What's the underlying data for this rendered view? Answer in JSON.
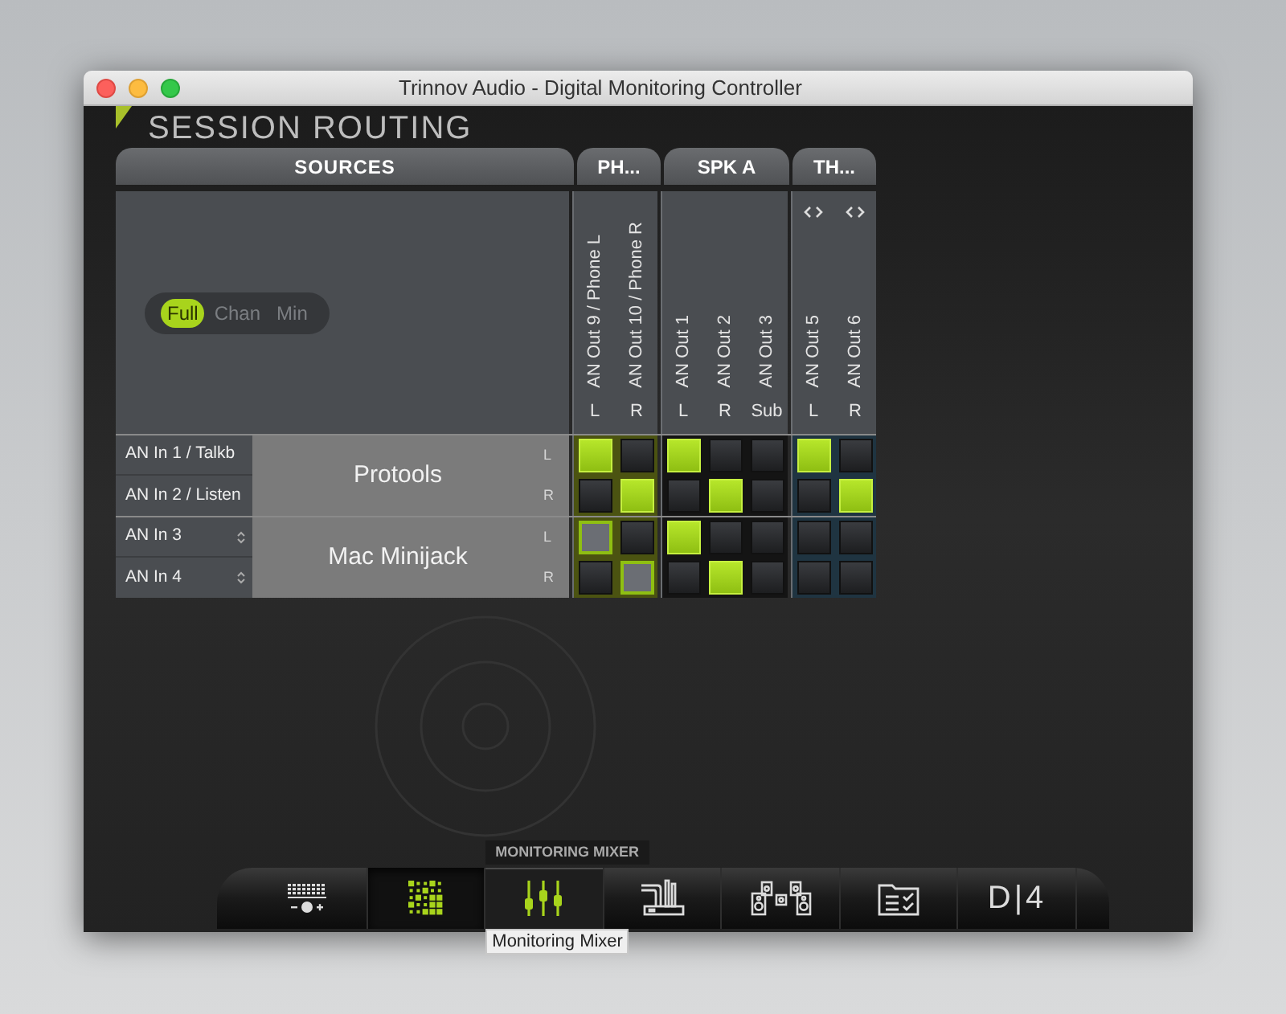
{
  "window": {
    "title": "Trinnov Audio - Digital Monitoring Controller"
  },
  "header": {
    "title": "SESSION ROUTING"
  },
  "sources_tab": "SOURCES",
  "view_toggle": [
    {
      "label": "Full",
      "selected": true
    },
    {
      "label": "Chan",
      "selected": false
    },
    {
      "label": "Min",
      "selected": false
    }
  ],
  "output_groups": [
    {
      "label": "PH...",
      "color": "#4b5311",
      "arrows": false,
      "columns": [
        {
          "name": "AN Out 9 / Phone L",
          "channel": "L"
        },
        {
          "name": "AN Out 10 / Phone R",
          "channel": "R"
        }
      ]
    },
    {
      "label": "SPK A",
      "color": "#141414",
      "arrows": false,
      "columns": [
        {
          "name": "AN Out 1",
          "channel": "L"
        },
        {
          "name": "AN Out 2",
          "channel": "R"
        },
        {
          "name": "AN Out 3",
          "channel": "Sub"
        }
      ]
    },
    {
      "label": "TH...",
      "color": "#1f3441",
      "arrows": true,
      "columns": [
        {
          "name": "AN Out 5",
          "channel": "L"
        },
        {
          "name": "AN Out 6",
          "channel": "R"
        }
      ]
    }
  ],
  "source_groups": [
    {
      "name": "Protools",
      "inputs": [
        {
          "name": "AN In 1 / Talkb",
          "channel": "L",
          "stepper": false,
          "routes": [
            [
              {
                "on": true,
                "pending": false
              },
              {
                "on": false,
                "pending": false
              }
            ],
            [
              {
                "on": true,
                "pending": false
              },
              {
                "on": false,
                "pending": false
              },
              {
                "on": false,
                "pending": false
              }
            ],
            [
              {
                "on": true,
                "pending": false
              },
              {
                "on": false,
                "pending": false
              }
            ]
          ]
        },
        {
          "name": "AN In 2 / Listen",
          "channel": "R",
          "stepper": false,
          "routes": [
            [
              {
                "on": false,
                "pending": false
              },
              {
                "on": true,
                "pending": false
              }
            ],
            [
              {
                "on": false,
                "pending": false
              },
              {
                "on": true,
                "pending": false
              },
              {
                "on": false,
                "pending": false
              }
            ],
            [
              {
                "on": false,
                "pending": false
              },
              {
                "on": true,
                "pending": false
              }
            ]
          ]
        }
      ]
    },
    {
      "name": "Mac Minijack",
      "inputs": [
        {
          "name": "AN In 3",
          "channel": "L",
          "stepper": true,
          "routes": [
            [
              {
                "on": false,
                "pending": true
              },
              {
                "on": false,
                "pending": false
              }
            ],
            [
              {
                "on": true,
                "pending": false
              },
              {
                "on": false,
                "pending": false
              },
              {
                "on": false,
                "pending": false
              }
            ],
            [
              {
                "on": false,
                "pending": false
              },
              {
                "on": false,
                "pending": false
              }
            ]
          ]
        },
        {
          "name": "AN In 4",
          "channel": "R",
          "stepper": true,
          "routes": [
            [
              {
                "on": false,
                "pending": false
              },
              {
                "on": false,
                "pending": true
              }
            ],
            [
              {
                "on": false,
                "pending": false
              },
              {
                "on": true,
                "pending": false
              },
              {
                "on": false,
                "pending": false
              }
            ],
            [
              {
                "on": false,
                "pending": false
              },
              {
                "on": false,
                "pending": false
              }
            ]
          ]
        }
      ]
    }
  ],
  "toolbar": [
    {
      "kind": "keyboard",
      "selected": false,
      "hovered": false
    },
    {
      "kind": "grid",
      "selected": true,
      "hovered": false
    },
    {
      "kind": "mixer",
      "selected": false,
      "hovered": true,
      "hover_label": "MONITORING MIXER",
      "tooltip": "Monitoring Mixer"
    },
    {
      "kind": "routing",
      "selected": false,
      "hovered": false
    },
    {
      "kind": "speakers",
      "selected": false,
      "hovered": false
    },
    {
      "kind": "presets",
      "selected": false,
      "hovered": false
    },
    {
      "kind": "logo",
      "selected": false,
      "hovered": false,
      "label": "D|4"
    }
  ]
}
